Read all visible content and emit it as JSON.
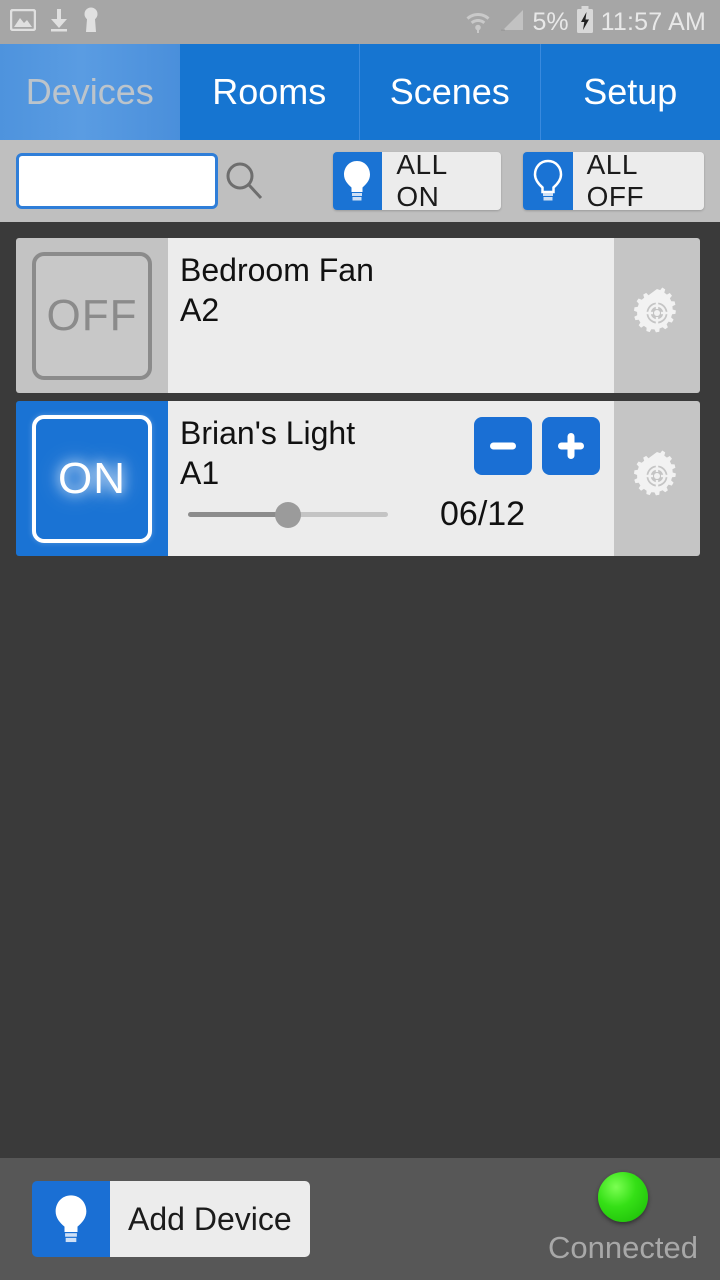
{
  "status_bar": {
    "left_icons": [
      "image-icon",
      "download-icon",
      "key-icon"
    ],
    "wifi_icon": "wifi-icon",
    "signal_icon": "signal-bars-icon",
    "battery_percent": "5%",
    "battery_icon": "battery-charging-icon",
    "time": "11:57 AM"
  },
  "tabs": [
    {
      "label": "Devices",
      "selected": true
    },
    {
      "label": "Rooms",
      "selected": false
    },
    {
      "label": "Scenes",
      "selected": false
    },
    {
      "label": "Setup",
      "selected": false
    }
  ],
  "search": {
    "value": "",
    "placeholder": "",
    "icon": "search-icon"
  },
  "all_buttons": [
    {
      "label": "ALL ON",
      "icon": "bulb-filled-icon",
      "name": "all-on-button"
    },
    {
      "label": "ALL OFF",
      "icon": "bulb-outline-icon",
      "name": "all-off-button"
    }
  ],
  "devices": [
    {
      "name": "Bedroom Fan",
      "code": "A2",
      "state_label": "OFF",
      "state": "off",
      "has_dimmer": false,
      "settings_icon": "gear-icon"
    },
    {
      "name": "Brian's Light",
      "code": "A1",
      "state_label": "ON",
      "state": "on",
      "has_dimmer": true,
      "dim_value": "06/12",
      "dim_percent": 50,
      "minus_label": "−",
      "plus_label": "+",
      "settings_icon": "gear-icon"
    }
  ],
  "bottom_bar": {
    "add_device_label": "Add Device",
    "add_device_icon": "bulb-filled-icon",
    "connection_label": "Connected",
    "connection_led_color": "#35e016"
  },
  "colors": {
    "accent_blue": "#1a73d4",
    "tab_blue": "#1675d1",
    "selected_tab_blue": "#5a9ce2",
    "status_bar_gray": "#a6a6a6",
    "search_bar_gray": "#bfbfbf",
    "content_gray": "#3a3a3a",
    "bottom_bar_gray": "#575757",
    "card_gray": "#ececec"
  }
}
